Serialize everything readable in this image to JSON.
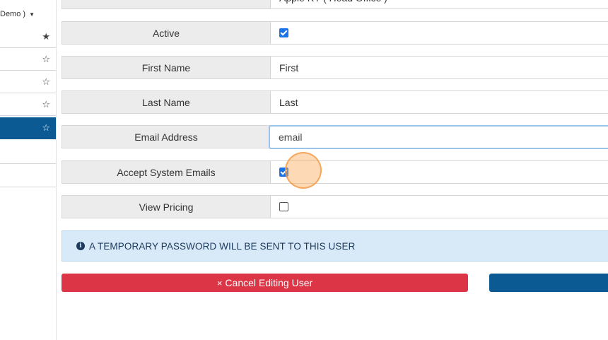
{
  "sidebar": {
    "top_label": "Demo )",
    "items": [
      {
        "icon": "star-filled-icon",
        "glyph": "★",
        "active": false
      },
      {
        "icon": "star-outline-icon",
        "glyph": "☆",
        "active": false
      },
      {
        "icon": "star-outline-icon",
        "glyph": "☆",
        "active": false
      },
      {
        "icon": "star-outline-icon",
        "glyph": "☆",
        "active": false
      },
      {
        "icon": "star-outline-icon",
        "glyph": "☆",
        "active": true
      },
      {
        "icon": "",
        "glyph": "",
        "active": false
      },
      {
        "icon": "",
        "glyph": "",
        "active": false
      }
    ]
  },
  "form": {
    "location_value": "Apple KY ( Head Office )",
    "active_label": "Active",
    "active_checked": true,
    "first_name_label": "First Name",
    "first_name_value": "First",
    "last_name_label": "Last Name",
    "last_name_value": "Last",
    "email_label": "Email Address",
    "email_value": "email",
    "accept_emails_label": "Accept System Emails",
    "accept_emails_checked": true,
    "view_pricing_label": "View Pricing",
    "view_pricing_checked": false
  },
  "alert": {
    "icon": "info-icon",
    "text": "A TEMPORARY PASSWORD WILL BE SENT TO THIS USER"
  },
  "buttons": {
    "cancel_label": "Cancel Editing User",
    "cancel_icon": "×"
  },
  "colors": {
    "primary": "#0b5a93",
    "danger": "#dc3545",
    "info_bg": "#d8e9f8"
  }
}
